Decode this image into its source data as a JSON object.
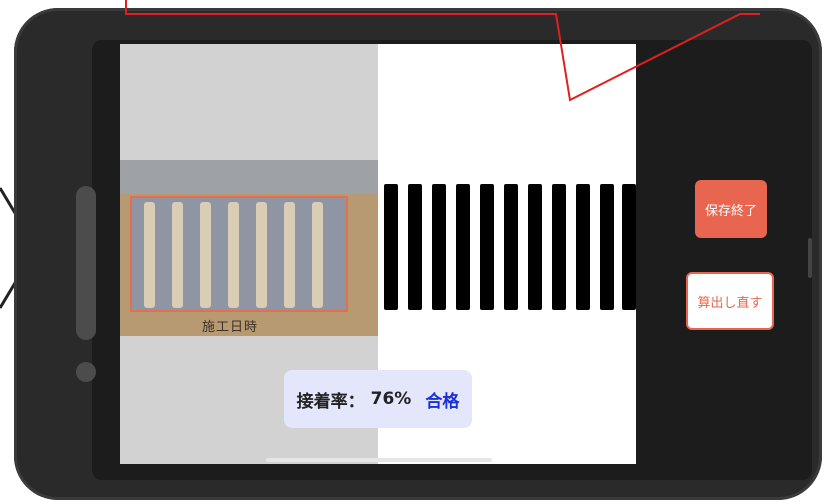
{
  "sample_photo": {
    "caption": "施工日時"
  },
  "result": {
    "rate_label": "接着率：",
    "rate_value": "76%",
    "verdict": "合格"
  },
  "buttons": {
    "save_finish": "保存終了",
    "recalculate": "算出し直す"
  },
  "colors": {
    "accent": "#e8664f",
    "verdict": "#1a2fd8",
    "result_bg": "#e4e6fb",
    "phone_body": "#2a2a2a"
  }
}
